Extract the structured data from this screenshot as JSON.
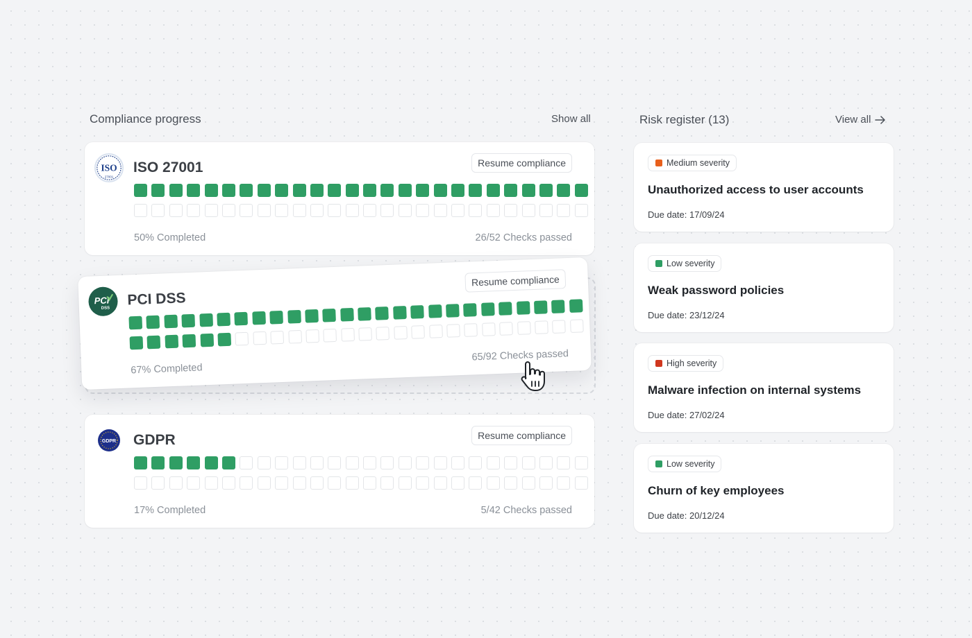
{
  "compliance": {
    "title": "Compliance progress",
    "show_all": "Show all",
    "frameworks": [
      {
        "name": "ISO 27001",
        "logo_icon": "iso-27001-logo",
        "logo_text": "ISO",
        "logo_subtext": "27001",
        "resume_label": "Resume compliance",
        "completed": "50% Completed",
        "checks": "26/52 Checks passed",
        "passed": 26,
        "total": 52
      },
      {
        "name": "PCI DSS",
        "logo_icon": "pci-dss-logo",
        "logo_text": "PCI",
        "logo_subtext": "DSS",
        "resume_label": "Resume compliance",
        "completed": "67% Completed",
        "checks": "65/92 Checks passed",
        "passed": 32,
        "total": 52
      },
      {
        "name": "GDPR",
        "logo_icon": "gdpr-logo",
        "logo_text": "GDPR",
        "logo_subtext": "",
        "resume_label": "Resume compliance",
        "completed": "17% Completed",
        "checks": "5/42 Checks passed",
        "passed": 6,
        "total": 52
      }
    ]
  },
  "risk": {
    "title": "Risk register (13)",
    "view_all": "View all",
    "items": [
      {
        "severity": "Medium severity",
        "color": "#e8601c",
        "title": "Unauthorized access to user accounts",
        "due": "Due date: 17/09/24"
      },
      {
        "severity": "Low severity",
        "color": "#2f9e64",
        "title": "Weak password policies",
        "due": "Due date: 23/12/24"
      },
      {
        "severity": "High severity",
        "color": "#d0371e",
        "title": "Malware infection on internal systems",
        "due": "Due date: 27/02/24"
      },
      {
        "severity": "Low severity",
        "color": "#2f9e64",
        "title": "Churn of key employees",
        "due": "Due date: 20/12/24"
      }
    ]
  },
  "colors": {
    "progress_on": "#2f9e64",
    "progress_off_border": "#e3e5e8"
  }
}
